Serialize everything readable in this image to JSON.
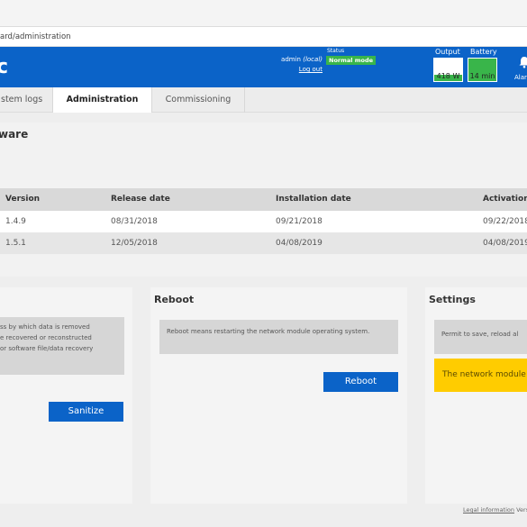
{
  "address": {
    "path": "ard/administration"
  },
  "header": {
    "brand": "c",
    "user": "admin",
    "user_scope": "(local)",
    "logout": "Log out",
    "status_label": "Status",
    "status_value": "Normal mode",
    "output_label": "Output",
    "output_value": "418 W",
    "battery_label": "Battery",
    "battery_value": "14 min",
    "alarms_label": "Alar"
  },
  "tabs": [
    {
      "label": "stem logs"
    },
    {
      "label": "Administration"
    },
    {
      "label": "Commissioning"
    }
  ],
  "firmware": {
    "title": "ware",
    "columns": [
      "Version",
      "Release date",
      "Installation date",
      "Activation"
    ],
    "rows": [
      [
        "1.4.9",
        "08/31/2018",
        "09/21/2018",
        "09/22/2018"
      ],
      [
        "1.5.1",
        "12/05/2018",
        "04/08/2019",
        "04/08/2019"
      ]
    ]
  },
  "sanitize": {
    "text_line1": "ss by which data is removed",
    "text_line2": "e recovered or reconstructed",
    "text_line3": "or software file/data recovery",
    "button": "Sanitize"
  },
  "reboot": {
    "title": "Reboot",
    "text": "Reboot means restarting the network module operating system.",
    "button": "Reboot"
  },
  "settings": {
    "title": "Settings",
    "text": "Permit to save, reload al",
    "warning": "The network module"
  },
  "footer": {
    "legal": "Legal information",
    "version": "Vers"
  },
  "colors": {
    "brand_blue": "#0b63c8",
    "status_green": "#39b54a",
    "warning_yellow": "#ffcc00"
  }
}
